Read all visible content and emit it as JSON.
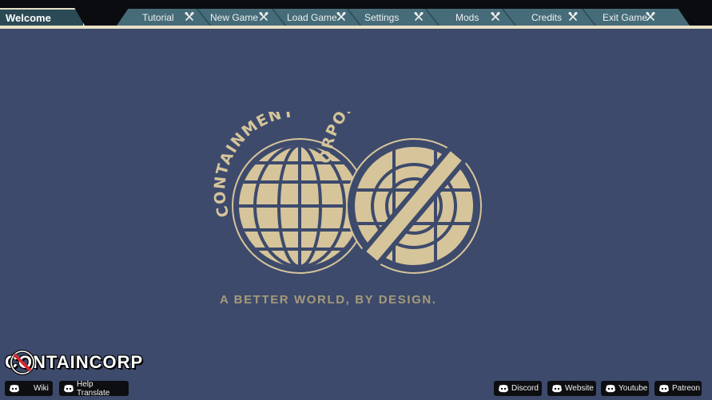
{
  "nav": {
    "welcome": "Welcome",
    "items": [
      {
        "label": "Tutorial"
      },
      {
        "label": "New Game"
      },
      {
        "label": "Load Game"
      },
      {
        "label": "Settings"
      },
      {
        "label": "Mods"
      },
      {
        "label": "Credits"
      },
      {
        "label": "Exit Game"
      }
    ]
  },
  "logo": {
    "arc_left": "CONTAINMENT",
    "arc_right": "CORPORATION",
    "tagline": "A BETTER WORLD, BY DESIGN."
  },
  "brand": {
    "name": "CONTAINCORP"
  },
  "bottom_left": [
    {
      "label": "Wiki",
      "icon": "discord-icon"
    },
    {
      "label": "Help Translate",
      "icon": "discord-icon"
    }
  ],
  "bottom_right": [
    {
      "label": "Discord",
      "icon": "discord-icon"
    },
    {
      "label": "Website",
      "icon": "discord-icon"
    },
    {
      "label": "Youtube",
      "icon": "discord-icon"
    },
    {
      "label": "Patreon",
      "icon": "discord-icon"
    }
  ],
  "colors": {
    "background": "#3d4a6c",
    "logo": "#d6c49a",
    "tab": "#456c78",
    "bar": "#0b0c10"
  }
}
